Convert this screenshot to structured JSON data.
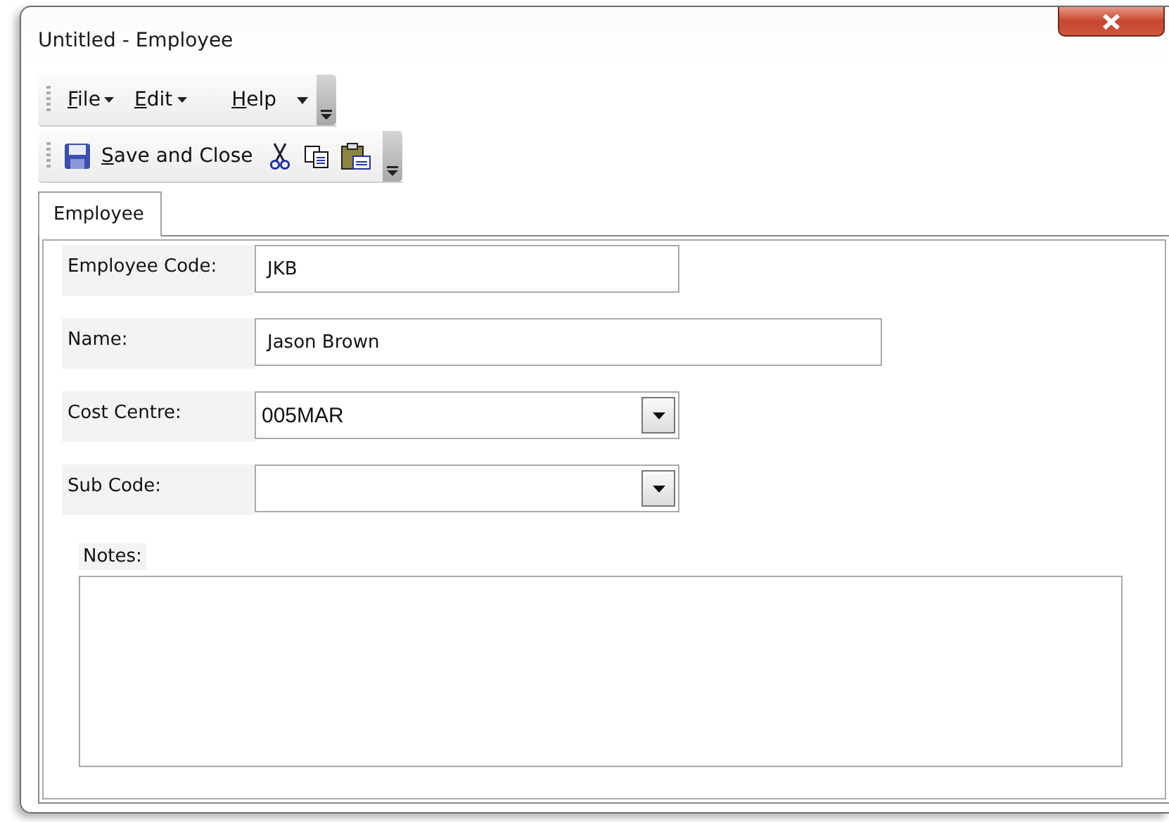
{
  "window": {
    "title": "Untitled - Employee"
  },
  "menu": [
    {
      "label": "File",
      "dropdown": true
    },
    {
      "label": "Edit",
      "dropdown": true
    },
    {
      "label": "Help",
      "dropdown": false
    }
  ],
  "toolbar": {
    "save_label": "Save and Close"
  },
  "tabs": [
    {
      "label": "Employee",
      "selected": true
    }
  ],
  "fields": [
    {
      "kind": "text",
      "label": "Employee Code:",
      "value": "JKB",
      "wide": false
    },
    {
      "kind": "text",
      "label": "Name:",
      "value": "Jason Brown",
      "wide": true
    },
    {
      "kind": "combo",
      "label": "Cost Centre:",
      "value": "005MAR",
      "wide": false
    },
    {
      "kind": "combo",
      "label": "Sub Code:",
      "wide": false
    }
  ],
  "notes": {
    "label": "Notes:"
  }
}
